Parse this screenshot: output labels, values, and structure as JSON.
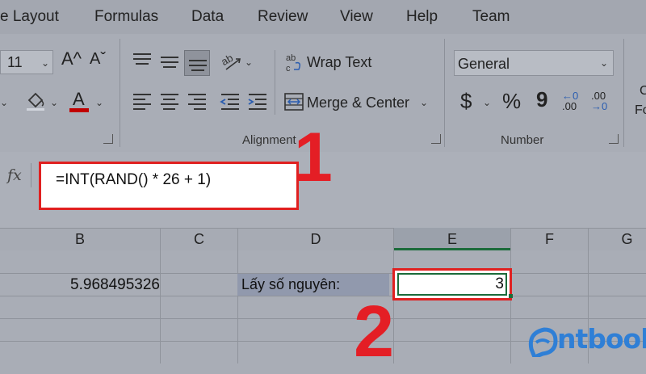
{
  "menu": [
    "e Layout",
    "Formulas",
    "Data",
    "Review",
    "View",
    "Help",
    "Team"
  ],
  "font": {
    "size": "11",
    "grow_label": "A^",
    "shrink_label": "Aˇ",
    "color_label": "A"
  },
  "alignment": {
    "wrap_text": "Wrap Text",
    "merge_center": "Merge & Center",
    "group_label": "Alignment"
  },
  "number": {
    "format": "General",
    "group_label": "Number",
    "currency": "$",
    "percent": "%",
    "comma": "9",
    "inc_decimal_top": "←0",
    "inc_decimal_bottom": ".00",
    "dec_decimal_top": ".00",
    "dec_decimal_bottom": "→0"
  },
  "cut_off": {
    "c": "C",
    "fo": "Fo"
  },
  "formula_bar": {
    "fx": "fx",
    "formula": "=INT(RAND() * 26 + 1)"
  },
  "annotations": {
    "one": "1",
    "two": "2"
  },
  "columns": [
    "B",
    "C",
    "D",
    "E",
    "F",
    "G"
  ],
  "cells": {
    "B": "5.968495326",
    "D": "Lấy số nguyên:",
    "E": "3"
  },
  "logo": {
    "text": "ntbook"
  },
  "colors": {
    "accent_red": "#e02020",
    "font_color_bar": "#c00000",
    "selection_green": "#1b6b3a",
    "logo_blue": "#2f7fd6"
  }
}
